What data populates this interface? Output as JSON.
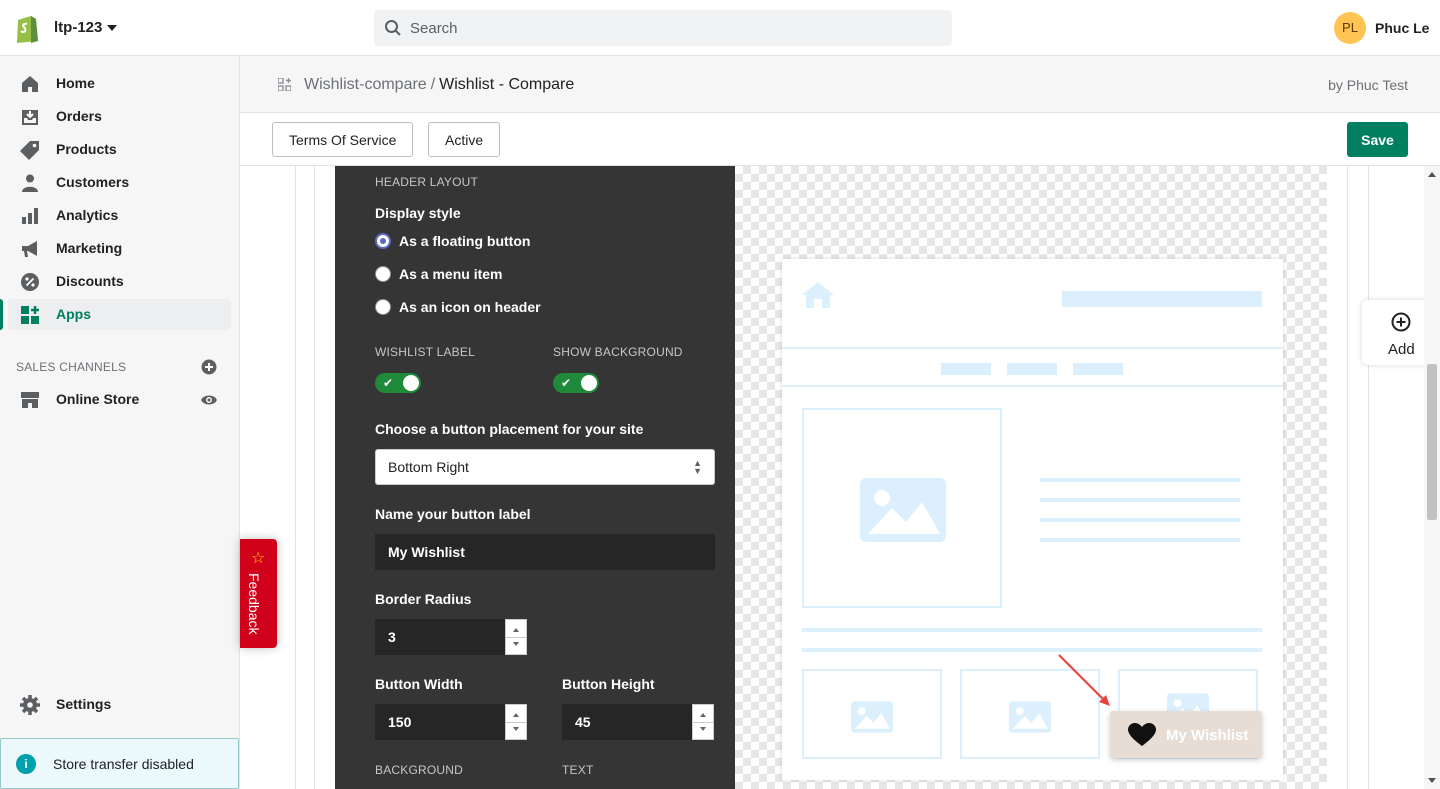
{
  "topbar": {
    "store_name": "ltp-123",
    "search_placeholder": "Search",
    "avatar_initials": "PL",
    "user_name": "Phuc Le"
  },
  "sidebar": {
    "items": [
      {
        "label": "Home",
        "icon": "home-icon"
      },
      {
        "label": "Orders",
        "icon": "orders-icon"
      },
      {
        "label": "Products",
        "icon": "tag-icon"
      },
      {
        "label": "Customers",
        "icon": "person-icon"
      },
      {
        "label": "Analytics",
        "icon": "bar-chart-icon"
      },
      {
        "label": "Marketing",
        "icon": "megaphone-icon"
      },
      {
        "label": "Discounts",
        "icon": "discount-icon"
      },
      {
        "label": "Apps",
        "icon": "apps-icon",
        "active": true
      }
    ],
    "sales_channels_label": "SALES CHANNELS",
    "online_store_label": "Online Store",
    "settings_label": "Settings",
    "store_transfer_text": "Store transfer disabled"
  },
  "feedback": {
    "label": "Feedback"
  },
  "header": {
    "breadcrumb_parent": "Wishlist-compare",
    "breadcrumb_separator": "/",
    "breadcrumb_current": "Wishlist - Compare",
    "byline": "by Phuc Test"
  },
  "actions": {
    "terms_label": "Terms Of Service",
    "active_label": "Active",
    "save_label": "Save"
  },
  "panel": {
    "section_title": "HEADER LAYOUT",
    "display_style_label": "Display style",
    "display_options": [
      {
        "label": "As a floating button",
        "checked": true
      },
      {
        "label": "As a menu item",
        "checked": false
      },
      {
        "label": "As an icon on header",
        "checked": false
      }
    ],
    "wishlist_label_title": "WISHLIST LABEL",
    "wishlist_label_on": true,
    "show_background_title": "SHOW BACKGROUND",
    "show_background_on": true,
    "placement_label": "Choose a button placement for your site",
    "placement_value": "Bottom Right",
    "button_label_title": "Name your button label",
    "button_label_value": "My Wishlist",
    "border_radius_title": "Border Radius",
    "border_radius_value": "3",
    "button_width_title": "Button Width",
    "button_width_value": "150",
    "button_height_title": "Button Height",
    "button_height_value": "45",
    "background_title": "BACKGROUND",
    "text_title": "TEXT"
  },
  "preview": {
    "fab_label": "My Wishlist"
  },
  "add_widget": {
    "label": "Add"
  },
  "colors": {
    "primary": "#008060",
    "panel_bg": "#353535",
    "toggle_on": "#1e8a3a",
    "feedback_bg": "#d0021b",
    "mock_line": "#dceffd",
    "fab_bg": "#e8ddd5"
  }
}
